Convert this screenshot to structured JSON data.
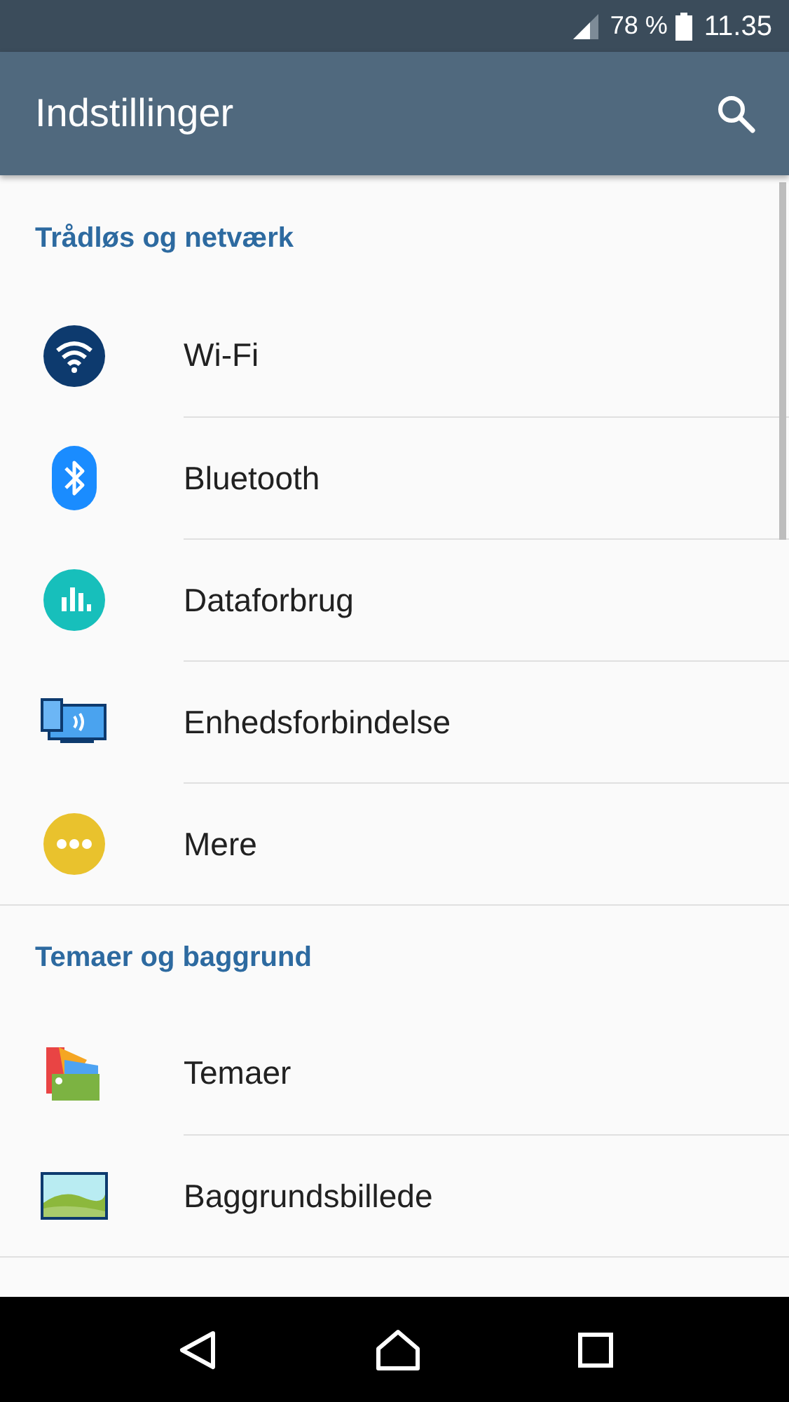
{
  "status_bar": {
    "battery": "78 %",
    "time": "11.35"
  },
  "app_bar": {
    "title": "Indstillinger"
  },
  "sections": [
    {
      "title": "Trådløs og netværk",
      "items": [
        {
          "label": "Wi-Fi"
        },
        {
          "label": "Bluetooth"
        },
        {
          "label": "Dataforbrug"
        },
        {
          "label": "Enhedsforbindelse"
        },
        {
          "label": "Mere"
        }
      ]
    },
    {
      "title": "Temaer og baggrund",
      "items": [
        {
          "label": "Temaer"
        },
        {
          "label": "Baggrundsbillede"
        }
      ]
    }
  ]
}
